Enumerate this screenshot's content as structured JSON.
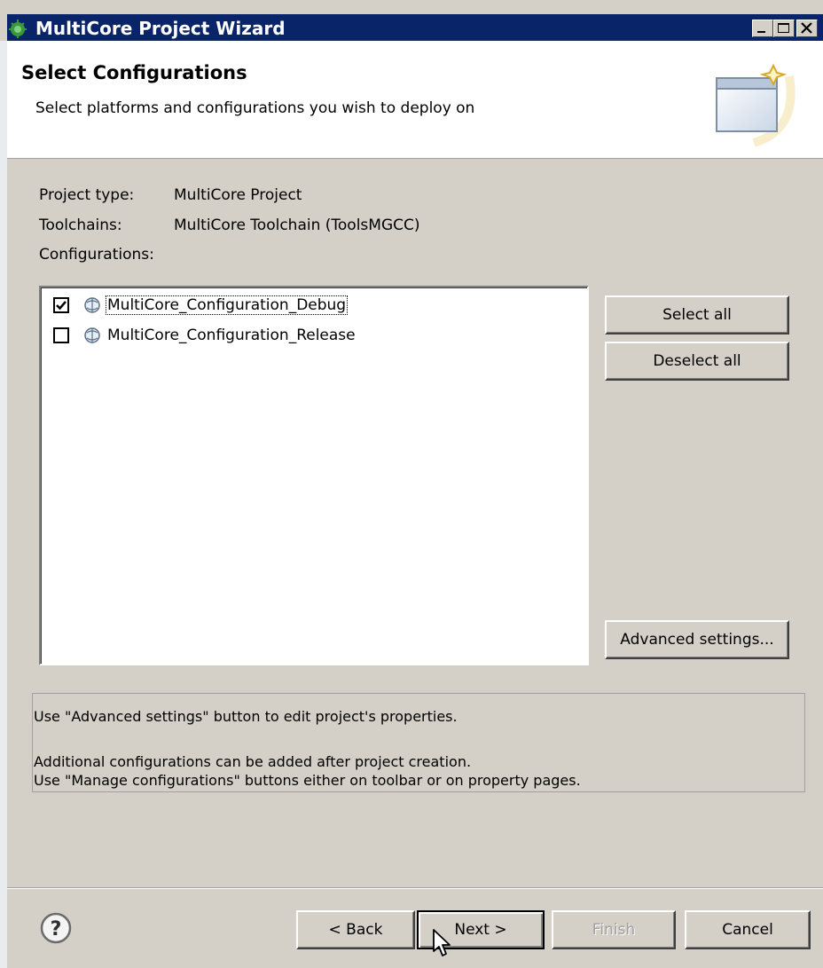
{
  "window": {
    "title": "MultiCore Project Wizard",
    "controls": {
      "minimize": "minimize-icon",
      "maximize": "maximize-icon",
      "close": "close-icon"
    }
  },
  "header": {
    "title": "Select Configurations",
    "subtitle": "Select platforms and configurations you wish to deploy on"
  },
  "details": {
    "project_type_label": "Project type:",
    "project_type_value": "MultiCore Project",
    "toolchains_label": "Toolchains:",
    "toolchains_value": "MultiCore Toolchain (ToolsMGCC)",
    "configurations_label": "Configurations:"
  },
  "configurations": [
    {
      "label": "MultiCore_Configuration_Debug",
      "checked": true,
      "icon": "configuration-icon"
    },
    {
      "label": "MultiCore_Configuration_Release",
      "checked": false,
      "icon": "configuration-icon"
    }
  ],
  "buttons": {
    "select_all": "Select all",
    "deselect_all": "Deselect all",
    "advanced_settings": "Advanced settings...",
    "back": "< Back",
    "next": "Next >",
    "finish": "Finish",
    "cancel": "Cancel"
  },
  "info": {
    "line1": "Use \"Advanced settings\" button to edit project's properties.",
    "line2": "Additional configurations can be added after project creation.",
    "line3": "Use \"Manage configurations\" buttons either on toolbar or on property pages."
  },
  "colors": {
    "titlebar": "#0a246a",
    "dialog_background": "#d4d0c8",
    "header_background": "#ffffff"
  }
}
